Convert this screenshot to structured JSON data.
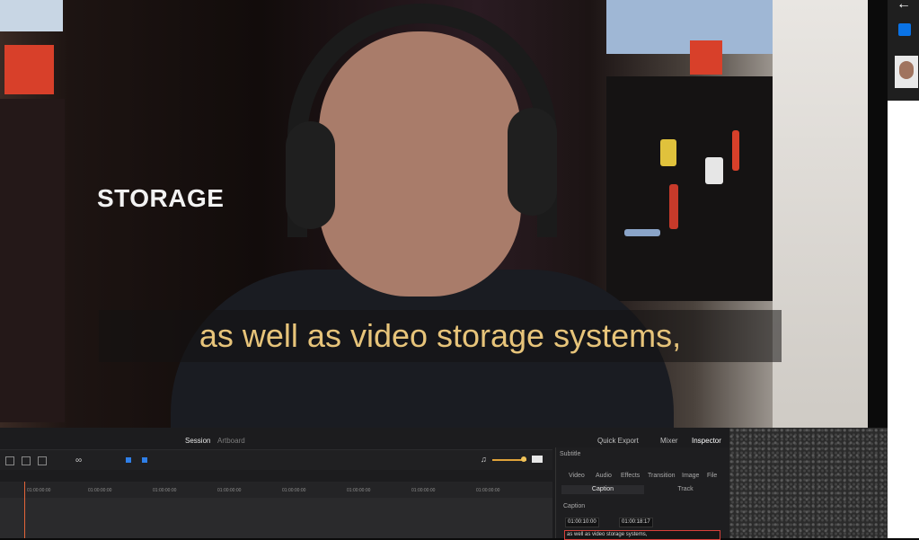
{
  "video": {
    "storage_label": "STORAGE",
    "subtitle": "as well as video storage systems,"
  },
  "editor": {
    "tab_session": "Session",
    "tab_other": "Artboard",
    "quick_export": "Quick Export",
    "mixer": "Mixer",
    "inspector": "Inspector",
    "ruler_ticks": [
      "01:00:00:00",
      "01:00:00:00",
      "01:00:00:00",
      "01:00:00:00",
      "01:00:00:00",
      "01:00:00:00",
      "01:00:00:00",
      "01:00:00:00"
    ],
    "inspector_title": "Subtitle",
    "inspector_tabs": [
      "Video",
      "Audio",
      "Effects",
      "Transition",
      "Image",
      "File"
    ],
    "caption_tab": "Caption",
    "track_tab": "Track",
    "caption_heading": "Caption",
    "tc_in": "01:00:10:00",
    "tc_out": "01:00:18:17",
    "caption_text": "as well as video storage systems,"
  },
  "colors": {
    "subtitle": "#e7c47a",
    "playhead": "#e3653a",
    "caption_border": "#d8403a"
  }
}
